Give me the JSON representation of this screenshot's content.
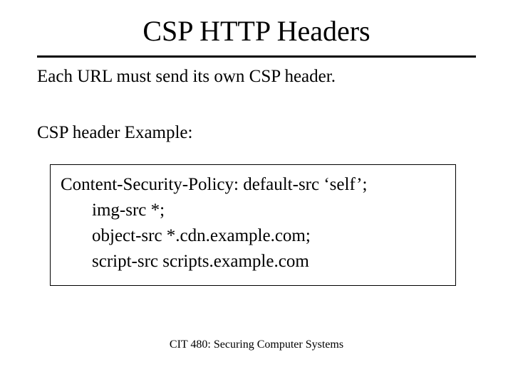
{
  "title": "CSP HTTP Headers",
  "body": {
    "line1": "Each URL must send its own CSP header.",
    "line2": "CSP header Example:"
  },
  "example": {
    "l1": "Content-Security-Policy: default-src ‘self’;",
    "l2": "img-src *;",
    "l3": "object-src *.cdn.example.com;",
    "l4": "script-src scripts.example.com"
  },
  "footer": "CIT 480: Securing Computer Systems"
}
